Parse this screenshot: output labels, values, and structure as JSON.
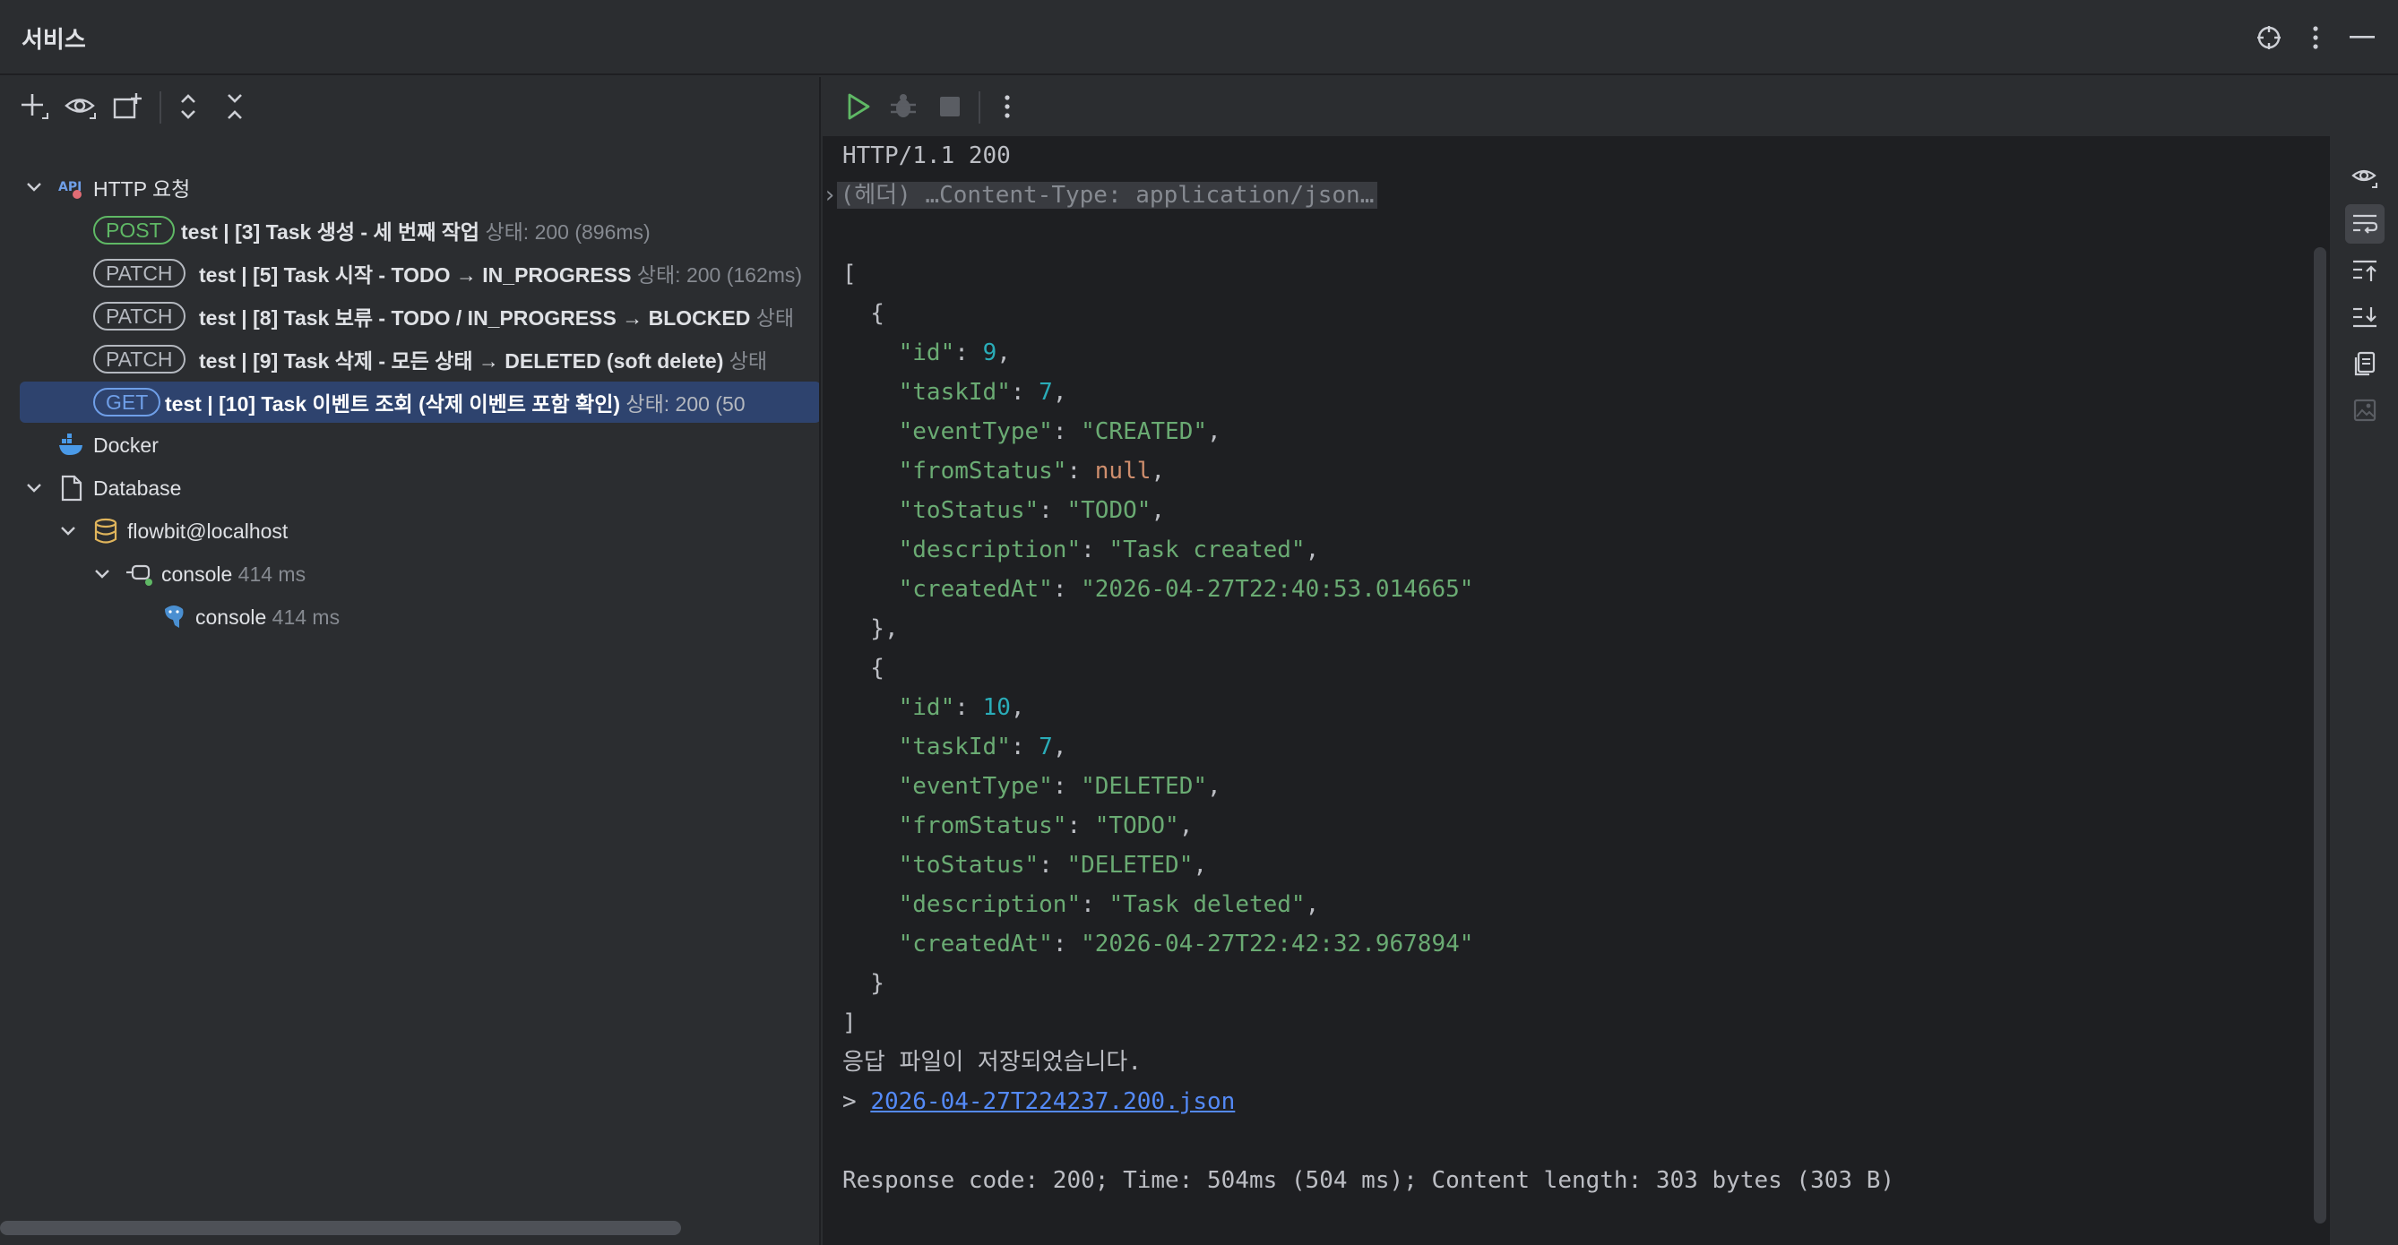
{
  "window": {
    "title": "서비스"
  },
  "tree": {
    "http_root": "HTTP 요청",
    "requests": [
      {
        "method": "POST",
        "label": "test  |  [3] Task 생성 - 세 번째 작업",
        "status": "상태: 200 (896ms)"
      },
      {
        "method": "PATCH",
        "label": "test  |  [5] Task 시작 - TODO → IN_PROGRESS",
        "status": "상태: 200 (162ms)"
      },
      {
        "method": "PATCH",
        "label": "test  |  [8] Task 보류 - TODO / IN_PROGRESS → BLOCKED",
        "status": "상태"
      },
      {
        "method": "PATCH",
        "label": "test  |  [9] Task 삭제 - 모든 상태 → DELETED (soft delete)",
        "status": "상태"
      },
      {
        "method": "GET",
        "label": "test  |  [10] Task 이벤트 조회 (삭제 이벤트 포함 확인)",
        "status": "상태: 200 (50"
      }
    ],
    "docker": "Docker",
    "database": "Database",
    "datasource": "flowbit@localhost",
    "console_group": {
      "label": "console",
      "time": "414 ms"
    },
    "console_item": {
      "label": "console",
      "time": "414 ms"
    }
  },
  "console": {
    "status_line": "HTTP/1.1 200",
    "headers_line": "(헤더) …Content-Type: application/json…",
    "events": [
      {
        "id": "9",
        "taskId": "7",
        "eventType": "\"CREATED\"",
        "fromStatus": "null",
        "toStatus": "\"TODO\"",
        "description": "\"Task created\"",
        "createdAt": "\"2026-04-27T22:40:53.014665\""
      },
      {
        "id": "10",
        "taskId": "7",
        "eventType": "\"DELETED\"",
        "fromStatus": "\"TODO\"",
        "toStatus": "\"DELETED\"",
        "description": "\"Task deleted\"",
        "createdAt": "\"2026-04-27T22:42:32.967894\""
      }
    ],
    "saved_msg": "응답 파일이 저장되었습니다.",
    "saved_file": "2026-04-27T224237.200.json",
    "summary": "Response code: 200; Time: 504ms (504 ms); Content length: 303 bytes (303 B)"
  },
  "colors": {
    "accent": "#548af7",
    "selection": "#2e436e",
    "run": "#5fb865"
  }
}
